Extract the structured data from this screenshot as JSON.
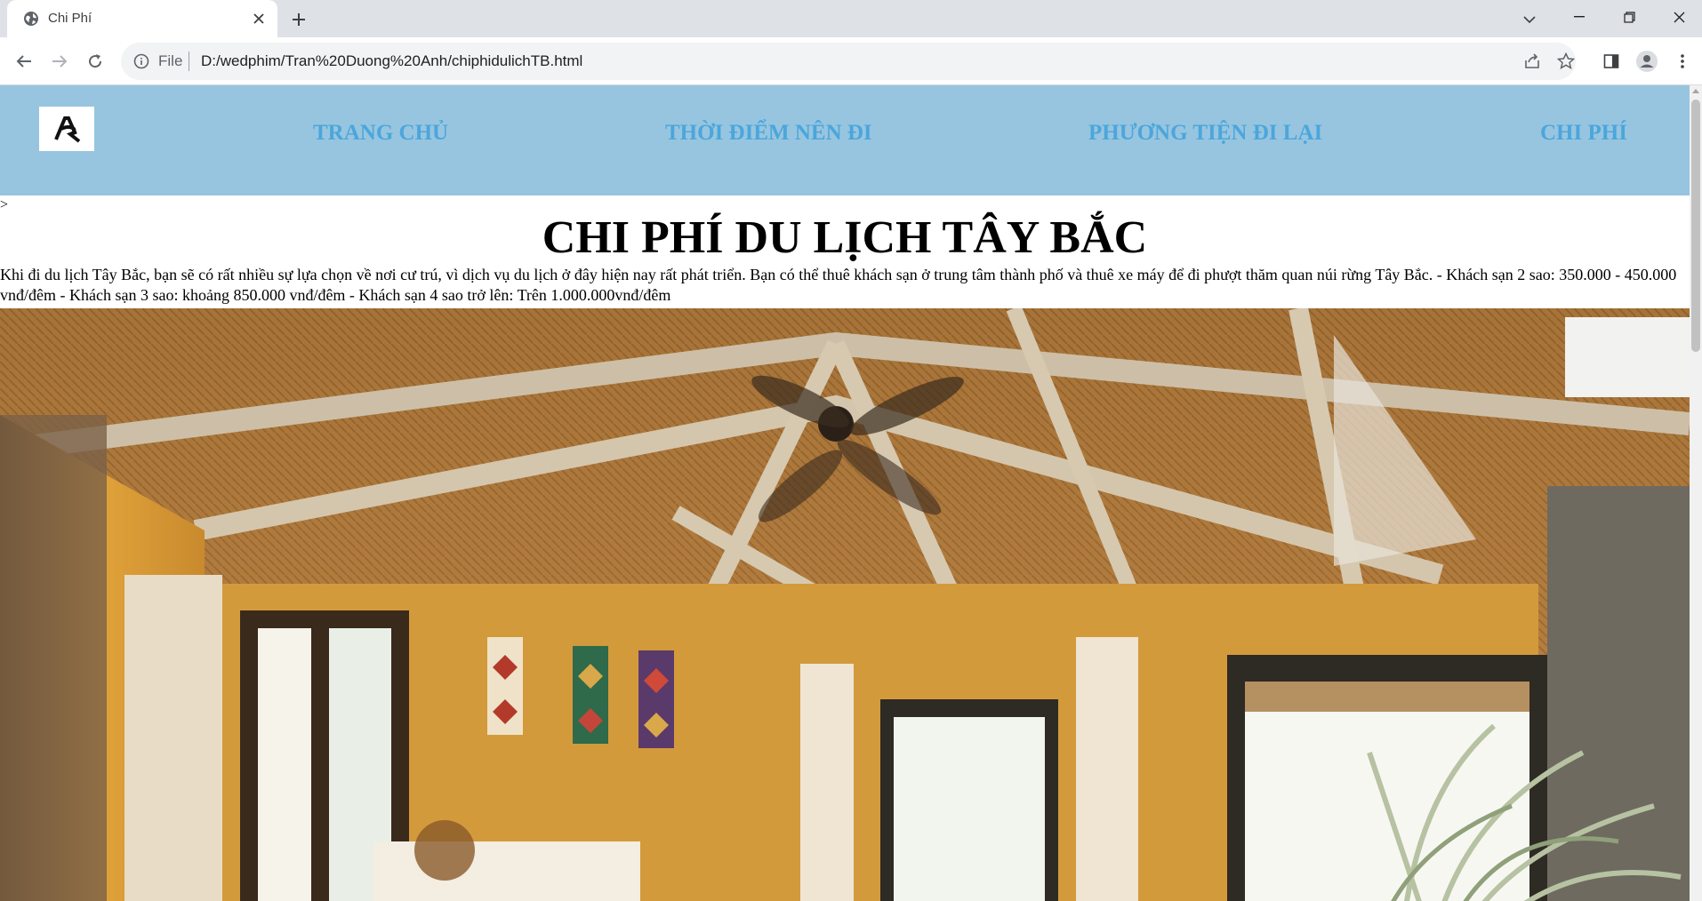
{
  "browser": {
    "tab_title": "Chi Phí",
    "scheme_label": "File",
    "url": "D:/wedphim/Tran%20Duong%20Anh/chiphidulichTB.html"
  },
  "icons": {
    "favicon": "globe-icon",
    "close": "close-icon",
    "new_tab": "plus-icon",
    "tab_search": "chevron-down-icon",
    "back": "arrow-left-icon",
    "forward": "arrow-right-icon",
    "reload": "reload-icon",
    "info": "info-icon",
    "share": "share-icon",
    "bookmark": "star-icon",
    "side_panel": "side-panel-icon",
    "profile": "profile-icon",
    "menu": "kebab-menu-icon",
    "logo": "logo-icon"
  },
  "site": {
    "nav": {
      "home": "TRANG CHỦ",
      "time": "THỜI ĐIỂM NÊN ĐI",
      "transport": "PHƯƠNG TIỆN ĐI LẠI",
      "cost": "CHI PHÍ"
    },
    "stray_text": ">",
    "title": "CHI PHÍ DU LỊCH TÂY BẮC",
    "intro": "Khi đi du lịch Tây Bắc, bạn sẽ có rất nhiều sự lựa chọn về nơi cư trú, vì dịch vụ du lịch ở đây hiện nay rất phát triển. Bạn có thể thuê khách sạn ở trung tâm thành phố và thuê xe máy để đi phượt thăm quan núi rừng Tây Bắc. - Khách sạn 2 sao: 350.000 - 450.000 vnđ/đêm - Khách sạn 3 sao: khoảng 850.000 vnđ/đêm - Khách sạn 4 sao trở lên: Trên 1.000.000vnđ/đêm"
  },
  "colors": {
    "header_bg": "#97c5df",
    "nav_text": "#4ba6dc",
    "tabbar_bg": "#dee1e6",
    "omnibox_bg": "#f1f3f4"
  }
}
